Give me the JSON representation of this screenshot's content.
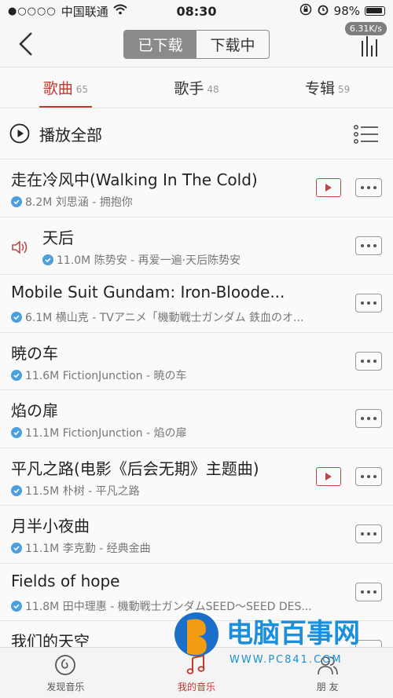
{
  "status": {
    "carrier": "中国联通",
    "time": "08:30",
    "battery": "98%"
  },
  "nav": {
    "segment_active": "已下载",
    "segment_inactive": "下载中",
    "speed": "6.31K/s"
  },
  "tabs": [
    {
      "label": "歌曲",
      "count": "65",
      "active": true
    },
    {
      "label": "歌手",
      "count": "48",
      "active": false
    },
    {
      "label": "专辑",
      "count": "59",
      "active": false
    }
  ],
  "play_all": "播放全部",
  "songs": [
    {
      "title": "走在冷风中(Walking In The Cold)",
      "sub": "8.2M 刘思涵 - 拥抱你",
      "mv": true,
      "playing": false
    },
    {
      "title": "天后",
      "sub": "11.0M 陈势安 - 再爱一遍·天后陈势安",
      "mv": false,
      "playing": true
    },
    {
      "title": "Mobile Suit Gundam: Iron-Bloode...",
      "sub": "6.1M 横山克 - TVアニメ「機動戦士ガンダム 鉄血のオ...",
      "mv": false,
      "playing": false
    },
    {
      "title": "暁の车",
      "sub": "11.6M FictionJunction - 暁の车",
      "mv": false,
      "playing": false
    },
    {
      "title": "焰の扉",
      "sub": "11.1M FictionJunction - 焰の扉",
      "mv": false,
      "playing": false
    },
    {
      "title": "平凡之路(电影《后会无期》主题曲)",
      "sub": "11.5M 朴树 - 平凡之路",
      "mv": true,
      "playing": false
    },
    {
      "title": "月半小夜曲",
      "sub": "11.1M 李克勤 - 经典金曲",
      "mv": false,
      "playing": false
    },
    {
      "title": "Fields of hope",
      "sub": "11.8M 田中理惠 - 機動戦士ガンダムSEED～SEED DES...",
      "mv": false,
      "playing": false
    },
    {
      "title": "我们的天空",
      "sub": "",
      "mv": false,
      "playing": false
    }
  ],
  "tabbar": [
    {
      "label": "发现音乐",
      "icon": "netease-logo-icon",
      "active": false
    },
    {
      "label": "我的音乐",
      "icon": "music-note-icon",
      "active": true
    },
    {
      "label": "朋 友",
      "icon": "friends-icon",
      "active": false
    }
  ],
  "watermark": {
    "text": "电脑百事网",
    "url": "WWW.PC841.COM"
  },
  "colors": {
    "accent": "#c0392b",
    "check": "#4a9fdc"
  }
}
